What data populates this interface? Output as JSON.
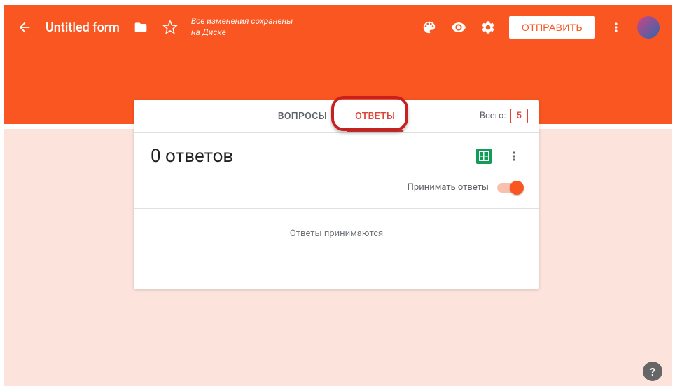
{
  "header": {
    "title": "Untitled form",
    "save_status": "Все изменения сохранены на Диске",
    "send_label": "ОТПРАВИТЬ"
  },
  "tabs": {
    "questions": "ВОПРОСЫ",
    "responses": "ОТВЕТЫ"
  },
  "card": {
    "total_label": "Всего:",
    "total_count": "5",
    "responses_title": "0 ответов",
    "accept_label": "Принимать ответы",
    "status_text": "Ответы принимаются"
  },
  "help_glyph": "?"
}
